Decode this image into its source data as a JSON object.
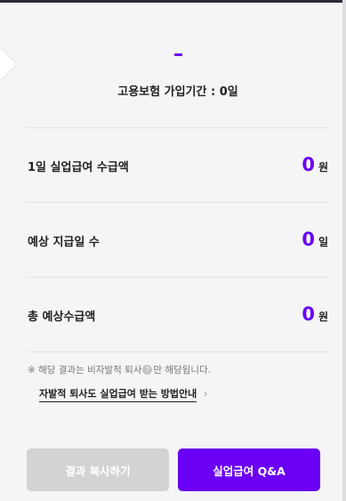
{
  "result": {
    "title_dash": "-",
    "period_text": "고용보험 가입기간 : 0일"
  },
  "rows": [
    {
      "label": "1일 실업급여 수급액",
      "value": "0",
      "unit": "원"
    },
    {
      "label": "예상 지급일 수",
      "value": "0",
      "unit": "일"
    },
    {
      "label": "총 예상수급액",
      "value": "0",
      "unit": "원"
    }
  ],
  "note": {
    "prefix": "※ 해당 결과는 비자발적 퇴사",
    "info_glyph": "?",
    "suffix": "만 해당됩니다."
  },
  "guide_link": {
    "label": "자발적 퇴사도 실업급여 받는 방법안내",
    "chevron": "›"
  },
  "buttons": {
    "copy_label": "결과 복사하기",
    "qa_label": "실업급여 Q&A"
  },
  "colors": {
    "accent": "#6a00f4",
    "disabled": "#d3d3d3",
    "background": "#f4f5f4"
  }
}
